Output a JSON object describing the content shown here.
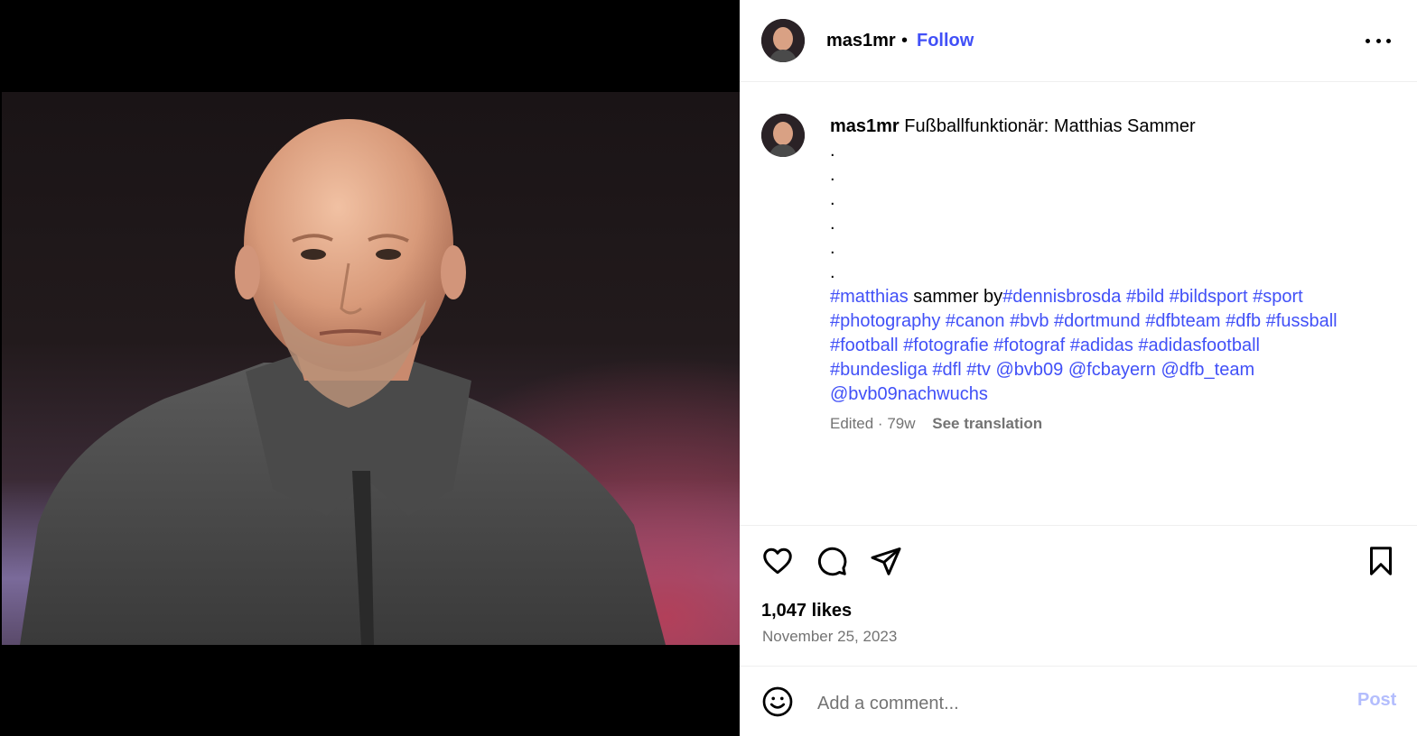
{
  "post": {
    "username": "mas1mr",
    "separator": "•",
    "follow_label": "Follow",
    "caption_text": "Fußballfunktionär: Matthias Sammer",
    "caption_dots": [
      ".",
      ".",
      ".",
      ".",
      ".",
      "."
    ],
    "hashtags_line1": {
      "t1": "#matthias",
      "plain1": " sammer by",
      "t2": "#dennisbrosda",
      "t3": "#bild",
      "t4": "#bildsport",
      "t5": "#sport"
    },
    "hashtags_line2": [
      "#photography",
      "#canon",
      "#bvb",
      "#dortmund",
      "#dfbteam",
      "#dfb",
      "#fussball"
    ],
    "hashtags_line3": [
      "#football",
      "#fotografie",
      "#fotograf",
      "#adidas",
      "#adidasfootball"
    ],
    "hashtags_line4": [
      "#bundesliga",
      "#dfl",
      "#tv",
      "@bvb09",
      "@fcbayern",
      "@dfb_team"
    ],
    "hashtags_line5": [
      "@bvb09nachwuchs"
    ],
    "edited": "Edited",
    "age": "79w",
    "see_translation": "See translation",
    "likes": "1,047 likes",
    "date": "November 25, 2023"
  },
  "comment": {
    "placeholder": "Add a comment...",
    "post_label": "Post"
  },
  "icons": {
    "more": "more-options-icon",
    "like": "heart-icon",
    "comment": "comment-bubble-icon",
    "share": "paper-plane-icon",
    "save": "bookmark-icon",
    "emoji": "emoji-smiley-icon"
  },
  "colors": {
    "link": "#4150f7",
    "muted": "#737373",
    "post_disabled": "#b3bdfd"
  }
}
